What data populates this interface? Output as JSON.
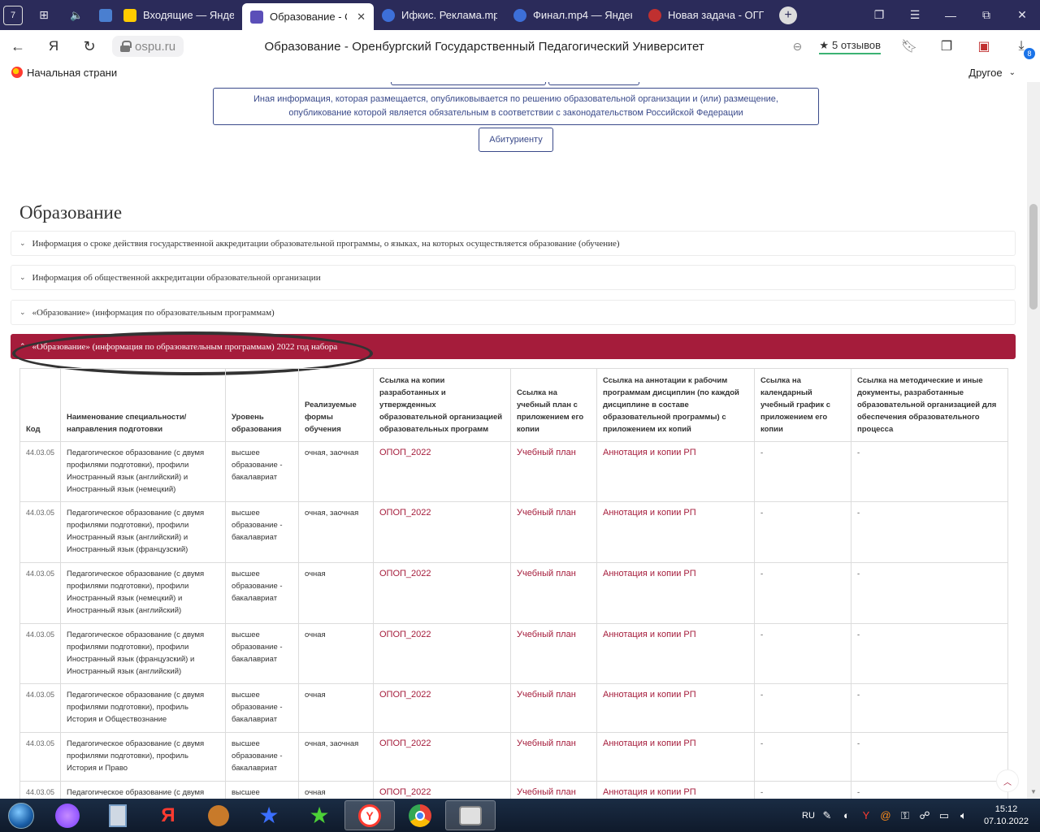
{
  "browser": {
    "home_badge": "7",
    "tabs": [
      {
        "title": "",
        "favicon_color": "#2b2b5a",
        "icon": "speaker-icon"
      },
      {
        "title": "",
        "favicon_color": "#4a7fd0",
        "icon": "shield-icon"
      },
      {
        "title": "Входящие — Яндекс",
        "favicon_color": "#ffcc00"
      },
      {
        "title": "Образование - Ор",
        "favicon_color": "#5b4fb8",
        "active": true
      },
      {
        "title": "Ифкис. Реклама.mp",
        "favicon_color": "#3d6fd8"
      },
      {
        "title": "Финал.mp4 — Яндекс",
        "favicon_color": "#3d6fd8"
      },
      {
        "title": "Новая задача - ОГП",
        "favicon_color": "#c03030"
      }
    ],
    "new_tab_label": "+",
    "url": "ospu.ru",
    "page_title": "Образование - Оренбургский Государственный Педагогический Университет",
    "reviews_label": "5 отзывов",
    "downloads_count": "8",
    "bookmark_home": "Начальная страни",
    "bookmark_other": "Другое"
  },
  "page": {
    "info_box_text": "Иная информация, которая размещается, опубликовывается по решению образовательной организации и (или) размещение, опубликование которой является обязательным в соответствии с законодательством Российской Федерации",
    "applicant_button": "Абитуриенту",
    "section_title": "Образование",
    "accordions": [
      "Информация о сроке действия государственной аккредитации образовательной программы, о языках, на которых осуществляется образование (обучение)",
      "Информация об общественной аккредитации образовательной организации",
      "«Образование» (информация по образовательным программам)",
      "«Образование» (информация по образовательным программам) 2022 год набора"
    ],
    "table": {
      "headers": [
        "Код",
        "Наименование специальности/ направления подготовки",
        "Уровень образования",
        "Реализуемые формы обучения",
        "Ссылка на копии разработанных и утвержденных образовательной организацией образовательных программ",
        "Ссылка на учебный план с приложением его копии",
        "Ссылка на аннотации к рабочим программам дисциплин (по каждой дисциплине в составе образовательной программы) с приложением их копий",
        "Ссылка на календарный учебный график с приложением его копии",
        "Ссылка на методические и иные документы, разработанные образовательной организацией для обеспечения образовательного процесса"
      ],
      "rows": [
        {
          "code": "44.03.05",
          "name": "Педагогическое образование (с двумя профилями подготовки), профили Иностранный язык (английский) и Иностранный язык (немецкий)",
          "level": "высшее образование - бакалавриат",
          "forms": "очная, заочная",
          "opop": "ОПОП_2022",
          "plan": "Учебный план",
          "annot": "Аннотация и копии РП",
          "calendar": "-",
          "methods": "-"
        },
        {
          "code": "44.03.05",
          "name": "Педагогическое образование (с двумя профилями подготовки), профили Иностранный язык (английский) и Иностранный язык (французский)",
          "level": "высшее образование - бакалавриат",
          "forms": "очная, заочная",
          "opop": "ОПОП_2022",
          "plan": "Учебный план",
          "annot": "Аннотация и копии РП",
          "calendar": "-",
          "methods": "-"
        },
        {
          "code": "44.03.05",
          "name": "Педагогическое образование (с двумя профилями подготовки), профили Иностранный язык (немецкий) и Иностранный язык (английский)",
          "level": "высшее образование - бакалавриат",
          "forms": "очная",
          "opop": "ОПОП_2022",
          "plan": "Учебный план",
          "annot": "Аннотация и копии РП",
          "calendar": "-",
          "methods": "-"
        },
        {
          "code": "44.03.05",
          "name": "Педагогическое образование (с двумя профилями подготовки), профили Иностранный язык (французский) и Иностранный язык (английский)",
          "level": "высшее образование - бакалавриат",
          "forms": "очная",
          "opop": "ОПОП_2022",
          "plan": "Учебный план",
          "annot": "Аннотация и копии РП",
          "calendar": "-",
          "methods": "-"
        },
        {
          "code": "44.03.05",
          "name": "Педагогическое образование (с двумя профилями подготовки), профиль История и Обществознание",
          "level": "высшее образование - бакалавриат",
          "forms": "очная",
          "opop": "ОПОП_2022",
          "plan": "Учебный план",
          "annot": "Аннотация и копии РП",
          "calendar": "-",
          "methods": "-"
        },
        {
          "code": "44.03.05",
          "name": "Педагогическое образование (с двумя профилями подготовки), профиль История и Право",
          "level": "высшее образование - бакалавриат",
          "forms": "очная, заочная",
          "opop": "ОПОП_2022",
          "plan": "Учебный план",
          "annot": "Аннотация и копии РП",
          "calendar": "-",
          "methods": "-"
        },
        {
          "code": "44.03.05",
          "name": "Педагогическое образование (с двумя",
          "level": "высшее",
          "forms": "очная",
          "opop": "ОПОП_2022",
          "plan": "Учебный план",
          "annot": "Аннотация и копии РП",
          "calendar": "-",
          "methods": "-"
        }
      ]
    }
  },
  "taskbar": {
    "language": "RU",
    "time": "15:12",
    "date": "07.10.2022"
  },
  "colors": {
    "accent": "#a51c3b",
    "link_border": "#3a4a8a",
    "tabbar": "#2b2b5a"
  }
}
